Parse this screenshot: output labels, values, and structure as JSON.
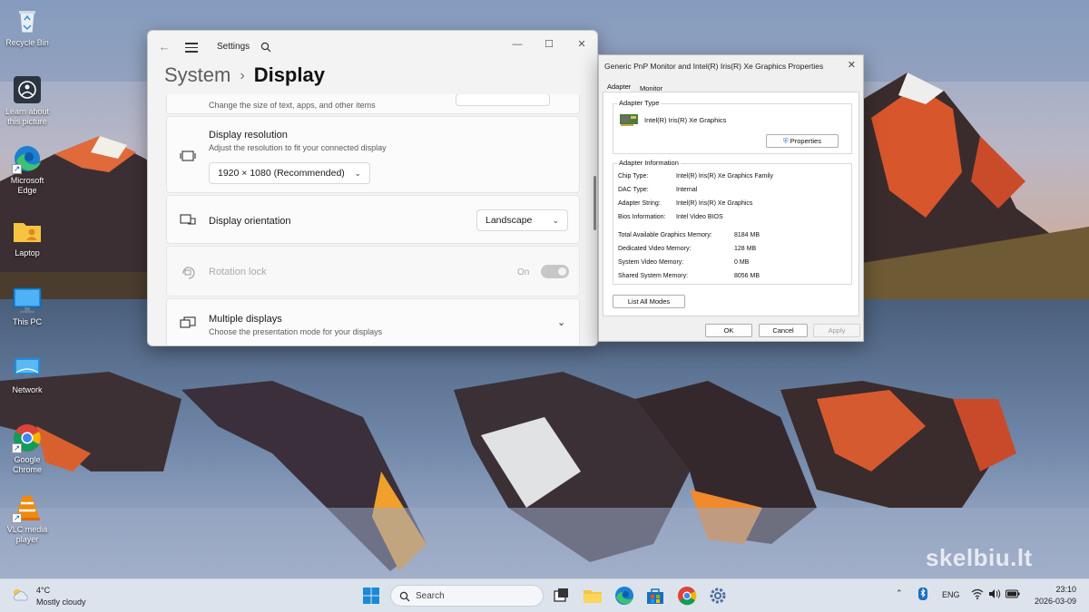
{
  "desktop": {
    "icons": [
      {
        "label": "Recycle Bin",
        "icon": "recycle-bin-icon"
      },
      {
        "label": "Learn about this picture",
        "icon": "learn-picture-icon"
      },
      {
        "label": "Microsoft Edge",
        "icon": "edge-icon"
      },
      {
        "label": "Laptop",
        "icon": "folder-user-icon"
      },
      {
        "label": "This PC",
        "icon": "monitor-icon"
      },
      {
        "label": "Network",
        "icon": "network-icon"
      },
      {
        "label": "Google Chrome",
        "icon": "chrome-icon"
      },
      {
        "label": "VLC media player",
        "icon": "vlc-icon"
      }
    ],
    "watermark": "skelbiu.lt"
  },
  "settings": {
    "window_title": "Settings",
    "breadcrumb_parent": "System",
    "breadcrumb_separator": "›",
    "page_title": "Display",
    "partial_text": "Change the size of text, apps, and other items",
    "resolution": {
      "title": "Display resolution",
      "subtitle": "Adjust the resolution to fit your connected display",
      "value": "1920 × 1080 (Recommended)"
    },
    "orientation": {
      "title": "Display orientation",
      "value": "Landscape"
    },
    "rotation_lock": {
      "title": "Rotation lock",
      "state": "On"
    },
    "multiple_displays": {
      "title": "Multiple displays",
      "subtitle": "Choose the presentation mode for your displays"
    }
  },
  "dialog": {
    "title": "Generic PnP Monitor and Intel(R) Iris(R) Xe Graphics Properties",
    "tabs": [
      "Adapter",
      "Monitor"
    ],
    "adapter_type_label": "Adapter Type",
    "adapter_name": "Intel(R) Iris(R) Xe Graphics",
    "properties_button": "Properties",
    "adapter_info_label": "Adapter Information",
    "info": [
      {
        "key": "Chip Type:",
        "value": "Intel(R) Iris(R) Xe Graphics Family"
      },
      {
        "key": "DAC Type:",
        "value": "Internal"
      },
      {
        "key": "Adapter String:",
        "value": "Intel(R) Iris(R) Xe Graphics"
      },
      {
        "key": "Bios Information:",
        "value": "Intel Video BIOS"
      }
    ],
    "memory": [
      {
        "key": "Total Available Graphics Memory:",
        "value": "8184 MB"
      },
      {
        "key": "Dedicated Video Memory:",
        "value": "128 MB"
      },
      {
        "key": "System Video Memory:",
        "value": "0 MB"
      },
      {
        "key": "Shared System Memory:",
        "value": "8056 MB"
      }
    ],
    "list_modes_button": "List All Modes",
    "ok_button": "OK",
    "cancel_button": "Cancel",
    "apply_button": "Apply"
  },
  "taskbar": {
    "weather_temp": "4°C",
    "weather_condition": "Mostly cloudy",
    "search_placeholder": "Search",
    "language": "ENG",
    "time": "23:10",
    "date": "2026-03-09"
  }
}
